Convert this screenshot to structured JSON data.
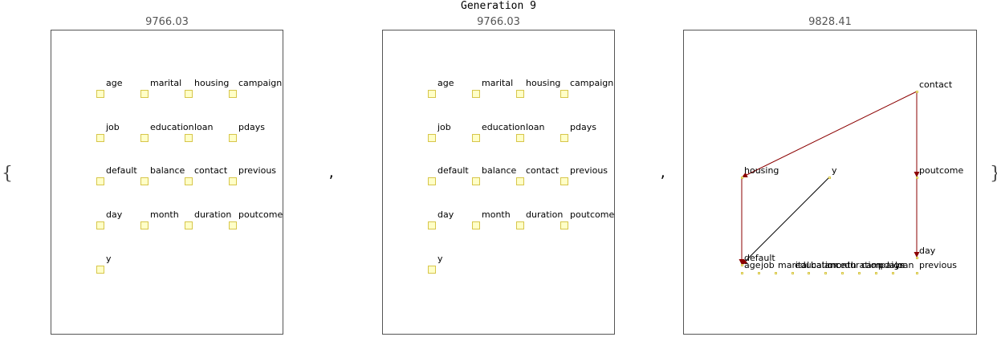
{
  "header": {
    "title": "Generation 9"
  },
  "separators": {
    "open_brace": "{",
    "close_brace": "}",
    "comma": ","
  },
  "edge_color": "#8b0000",
  "node_color": "#ffffc8",
  "panels": [
    {
      "score": "9766.03",
      "nodes": [
        "age",
        "marital",
        "housing",
        "campaign",
        "job",
        "education",
        "loan",
        "pdays",
        "default",
        "balance",
        "contact",
        "previous",
        "day",
        "month",
        "duration",
        "poutcome",
        "y"
      ],
      "edges": []
    },
    {
      "score": "9766.03",
      "nodes": [
        "age",
        "marital",
        "housing",
        "campaign",
        "job",
        "education",
        "loan",
        "pdays",
        "default",
        "balance",
        "contact",
        "previous",
        "day",
        "month",
        "duration",
        "poutcome",
        "y"
      ],
      "edges": []
    },
    {
      "score": "9828.41",
      "nodes": [
        "contact",
        "housing",
        "y",
        "poutcome",
        "default",
        "day",
        "age",
        "job",
        "marital",
        "education",
        "balance",
        "month",
        "duration",
        "campaign",
        "pdays",
        "loan",
        "previous"
      ],
      "edges": [
        {
          "from": "contact",
          "to": "housing"
        },
        {
          "from": "contact",
          "to": "poutcome"
        },
        {
          "from": "housing",
          "to": "default"
        },
        {
          "from": "y",
          "to": "default"
        },
        {
          "from": "poutcome",
          "to": "day"
        }
      ]
    }
  ]
}
